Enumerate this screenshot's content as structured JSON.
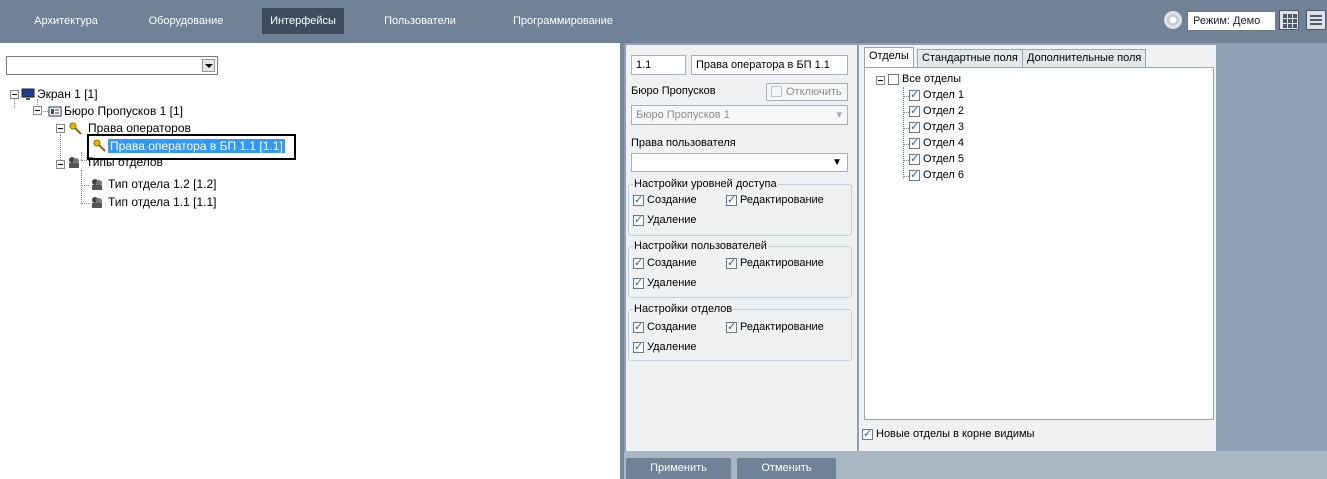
{
  "topbar": {
    "tabs": [
      {
        "label": "Архитектура"
      },
      {
        "label": "Оборудование"
      },
      {
        "label": "Интерфейсы",
        "active": true
      },
      {
        "label": "Пользователи"
      },
      {
        "label": "Программирование"
      }
    ],
    "mode_label": "Режим: Демо",
    "mode_icon": "gear-icon",
    "grid_icon": "grid-view-icon",
    "menu_icon": "menu-icon"
  },
  "left": {
    "dropdown_value": "",
    "tree": [
      {
        "label": "Экран 1 [1]",
        "icon": "monitor-icon"
      },
      {
        "label": "Бюро Пропусков 1 [1]",
        "icon": "badge-office-icon"
      },
      {
        "label": "Права операторов",
        "icon": "key-icon"
      },
      {
        "label": "Права оператора в БП 1.1 [1.1]",
        "icon": "key-icon",
        "selected": true
      },
      {
        "label": "Типы отделов",
        "icon": "department-icon"
      },
      {
        "label": "Тип отдела 1.2 [1.2]",
        "icon": "department-icon"
      },
      {
        "label": "Тип отдела 1.1 [1.1]",
        "icon": "department-icon"
      }
    ]
  },
  "props": {
    "id_value": "1.1",
    "name_value": "Права оператора в БП 1.1",
    "bureau_label": "Бюро Пропусков",
    "disable_label": "Отключить",
    "bureau_value": "Бюро Пропусков 1",
    "user_rights_label": "Права пользователя",
    "user_rights_value": "",
    "groups": [
      {
        "title": "Настройки уровней доступа",
        "create": "Создание",
        "edit": "Редактирование",
        "delete": "Удаление"
      },
      {
        "title": "Настройки пользователей",
        "create": "Создание",
        "edit": "Редактирование",
        "delete": "Удаление"
      },
      {
        "title": "Настройки отделов",
        "create": "Создание",
        "edit": "Редактирование",
        "delete": "Удаление"
      }
    ]
  },
  "depts": {
    "tabs": [
      "Отделы",
      "Стандартные поля",
      "Дополнительные поля"
    ],
    "root": "Все отделы",
    "items": [
      "Отдел 1",
      "Отдел 2",
      "Отдел 3",
      "Отдел 4",
      "Отдел 5",
      "Отдел 6"
    ],
    "new_in_root_label": "Новые отделы в корне видимы"
  },
  "buttons": {
    "apply": "Применить",
    "cancel": "Отменить"
  }
}
